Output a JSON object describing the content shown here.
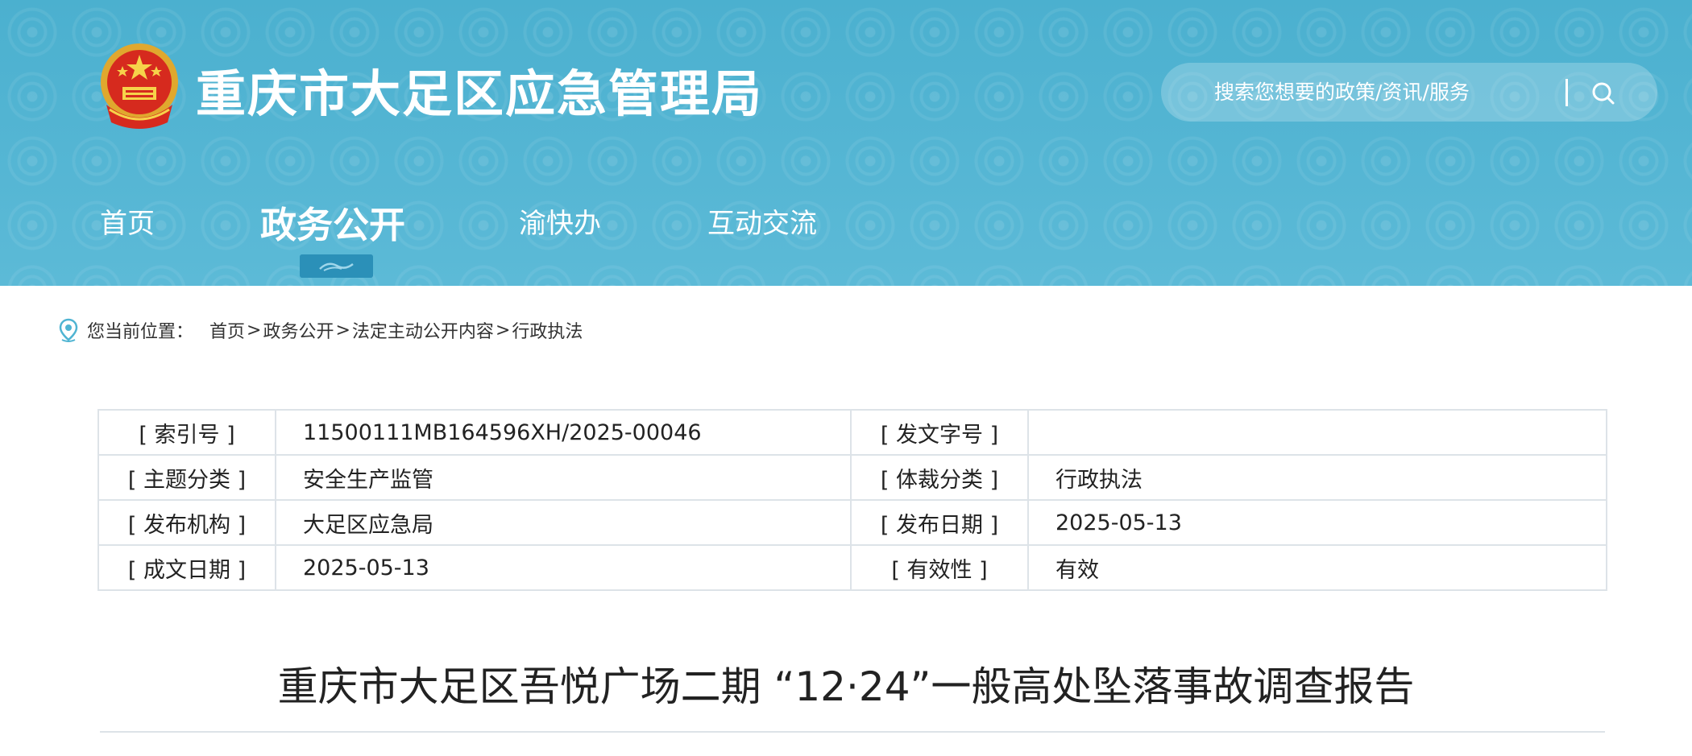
{
  "header": {
    "site_title": "重庆市大足区应急管理局",
    "emblem_icon": "national-emblem-icon",
    "search": {
      "placeholder": "搜索您想要的政策/资讯/服务",
      "icon": "search-icon"
    },
    "nav": [
      {
        "label": "首页",
        "active": false
      },
      {
        "label": "政务公开",
        "active": true
      },
      {
        "label": "渝快办",
        "active": false
      },
      {
        "label": "互动交流",
        "active": false
      }
    ],
    "colors": {
      "banner": "#4fb4d2",
      "indicator": "#2b90b8",
      "text": "#ffffff"
    }
  },
  "breadcrumb": {
    "icon": "location-pin-icon",
    "label": "您当前位置：",
    "items": [
      "首页",
      "政务公开",
      "法定主动公开内容",
      "行政执法"
    ],
    "separator": ">"
  },
  "meta": {
    "rows": [
      {
        "k1": "[ 索引号 ]",
        "v1": "11500111MB164596XH/2025-00046",
        "k2": "[ 发文字号 ]",
        "v2": ""
      },
      {
        "k1": "[ 主题分类 ]",
        "v1": "安全生产监管",
        "k2": "[ 体裁分类 ]",
        "v2": "行政执法"
      },
      {
        "k1": "[ 发布机构 ]",
        "v1": "大足区应急局",
        "k2": "[ 发布日期 ]",
        "v2": "2025-05-13"
      },
      {
        "k1": "[ 成文日期 ]",
        "v1": "2025-05-13",
        "k2": "[ 有效性 ]",
        "v2": "有效"
      }
    ]
  },
  "article": {
    "title": "重庆市大足区吾悦广场二期 “12·24”一般高处坠落事故调查报告"
  }
}
